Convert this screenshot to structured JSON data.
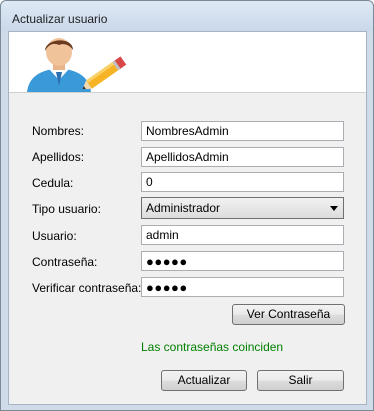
{
  "window": {
    "title": "Actualizar usuario"
  },
  "form": {
    "nombres_label": "Nombres:",
    "nombres_value": "NombresAdmin",
    "apellidos_label": "Apellidos:",
    "apellidos_value": "ApellidosAdmin",
    "cedula_label": "Cedula:",
    "cedula_value": "0",
    "tipo_label": "Tipo usuario:",
    "tipo_value": "Administrador",
    "usuario_label": "Usuario:",
    "usuario_value": "admin",
    "contrasena_label": "Contraseña:",
    "contrasena_mask": "●●●●●",
    "verificar_label": "Verificar contraseña:",
    "verificar_mask": "●●●●●"
  },
  "buttons": {
    "ver_contrasena": "Ver Contraseña",
    "actualizar": "Actualizar",
    "salir": "Salir"
  },
  "status": {
    "match_message": "Las contraseñas coinciden",
    "match_color": "#008000"
  },
  "icons": {
    "banner": "user-edit-icon",
    "dropdown": "chevron-down-icon"
  }
}
